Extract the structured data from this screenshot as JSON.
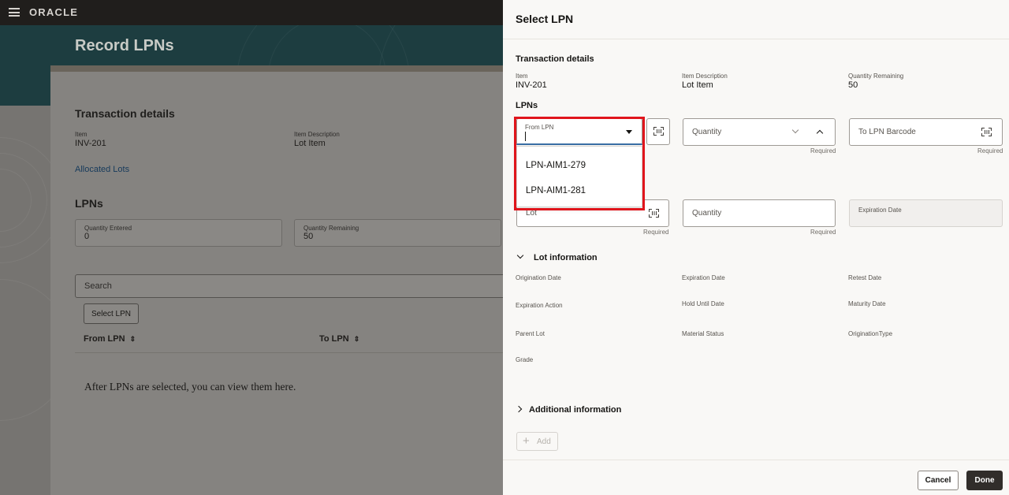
{
  "app": {
    "logo": "ORACLE"
  },
  "page": {
    "title": "Record LPNs",
    "transaction_title": "Transaction details",
    "item_label": "Item",
    "item_value": "INV-201",
    "item_desc_label": "Item Description",
    "item_desc_value": "Lot Item",
    "allocated_lots_link": "Allocated Lots",
    "lpns_title": "LPNs",
    "qty_entered_label": "Quantity Entered",
    "qty_entered_value": "0",
    "qty_remaining_label": "Quantity Remaining",
    "qty_remaining_value": "50",
    "search_placeholder": "Search",
    "select_lpn_button": "Select LPN",
    "columns": [
      "From LPN",
      "To LPN"
    ],
    "empty_message": "After LPNs are selected, you can view them here."
  },
  "drawer": {
    "title": "Select LPN",
    "transaction_title": "Transaction details",
    "item_label": "Item",
    "item_value": "INV-201",
    "item_desc_label": "Item Description",
    "item_desc_value": "Lot Item",
    "qty_remaining_label": "Quantity Remaining",
    "qty_remaining_value": "50",
    "lpns_title": "LPNs",
    "from_lpn_label": "From LPN",
    "from_lpn_options": [
      "LPN-AIM1-279",
      "LPN-AIM1-281"
    ],
    "quantity_placeholder": "Quantity",
    "to_lpn_placeholder": "To LPN Barcode",
    "required_text": "Required",
    "lot_placeholder": "Lot",
    "lot_quantity_placeholder": "Quantity",
    "expiration_date_label": "Expiration Date",
    "lot_info_title": "Lot information",
    "lot_info_fields": {
      "origination_date": "Origination Date",
      "expiration_date": "Expiration Date",
      "retest_date": "Retest Date",
      "expiration_action": "Expiration Action",
      "hold_until_date": "Hold Until Date",
      "maturity_date": "Maturity Date",
      "parent_lot": "Parent Lot",
      "material_status": "Material Status",
      "origination_type": "OriginationType",
      "grade": "Grade"
    },
    "additional_info_title": "Additional information",
    "add_button": "Add",
    "cancel_button": "Cancel",
    "done_button": "Done"
  },
  "colors": {
    "highlight_border": "#e0151c",
    "focus_underline": "#3a6ea5",
    "done_button_bg": "#312d2a"
  }
}
